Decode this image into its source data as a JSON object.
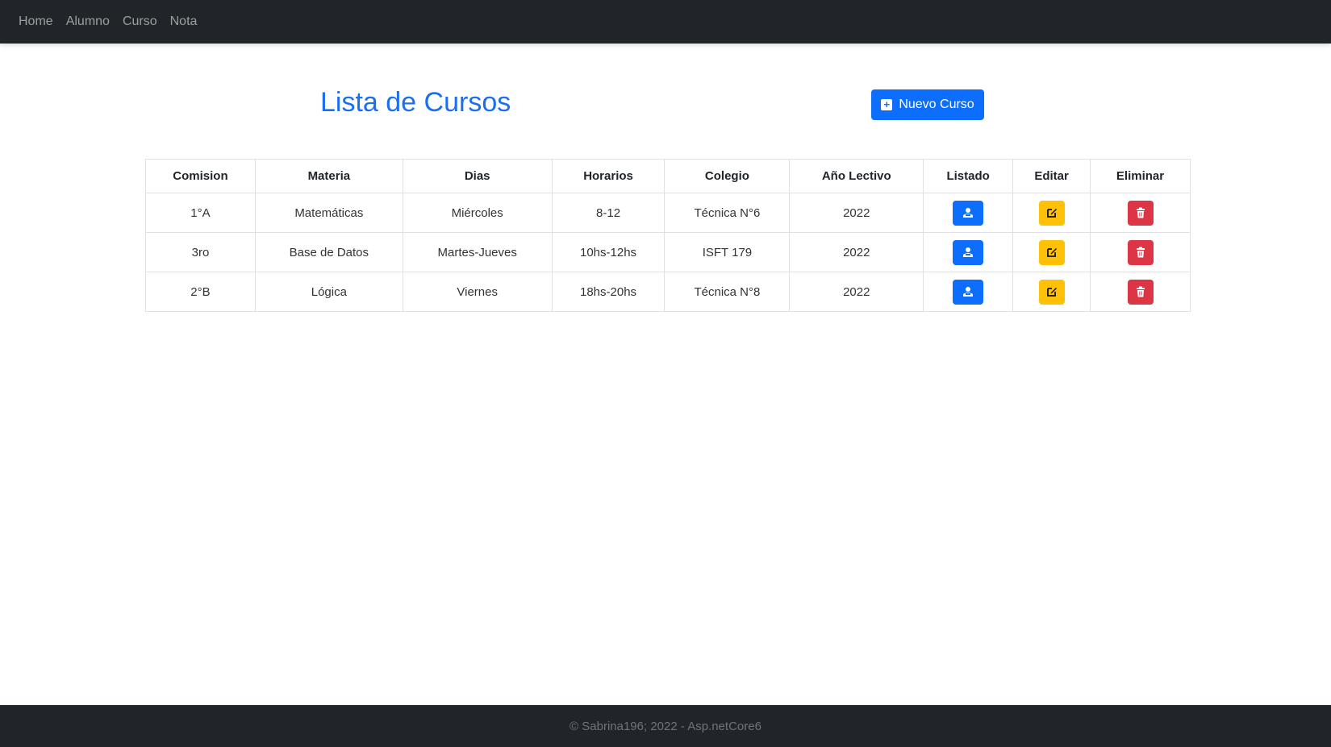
{
  "nav": {
    "items": [
      "Home",
      "Alumno",
      "Curso",
      "Nota"
    ]
  },
  "page": {
    "title": "Lista de Cursos",
    "new_button_label": "Nuevo Curso"
  },
  "table": {
    "headers": [
      "Comision",
      "Materia",
      "Dias",
      "Horarios",
      "Colegio",
      "Año Lectivo",
      "Listado",
      "Editar",
      "Eliminar"
    ],
    "rows": [
      {
        "comision": "1°A",
        "materia": "Matemáticas",
        "dias": "Miércoles",
        "horarios": "8-12",
        "colegio": "Técnica N°6",
        "anio": "2022"
      },
      {
        "comision": "3ro",
        "materia": "Base de Datos",
        "dias": "Martes-Jueves",
        "horarios": "10hs-12hs",
        "colegio": "ISFT 179",
        "anio": "2022"
      },
      {
        "comision": "2°B",
        "materia": "Lógica",
        "dias": "Viernes",
        "horarios": "18hs-20hs",
        "colegio": "Técnica N°8",
        "anio": "2022"
      }
    ]
  },
  "icons": {
    "new": "plus-square-icon",
    "list": "person-list-icon",
    "edit": "pencil-square-icon",
    "delete": "trash-icon"
  },
  "colors": {
    "primary": "#0d6efd",
    "warning": "#ffc107",
    "danger": "#dc3545",
    "dark": "#212529",
    "title": "#1a6ef0"
  },
  "footer": {
    "text": "© Sabrina196; 2022 - Asp.netCore6"
  }
}
